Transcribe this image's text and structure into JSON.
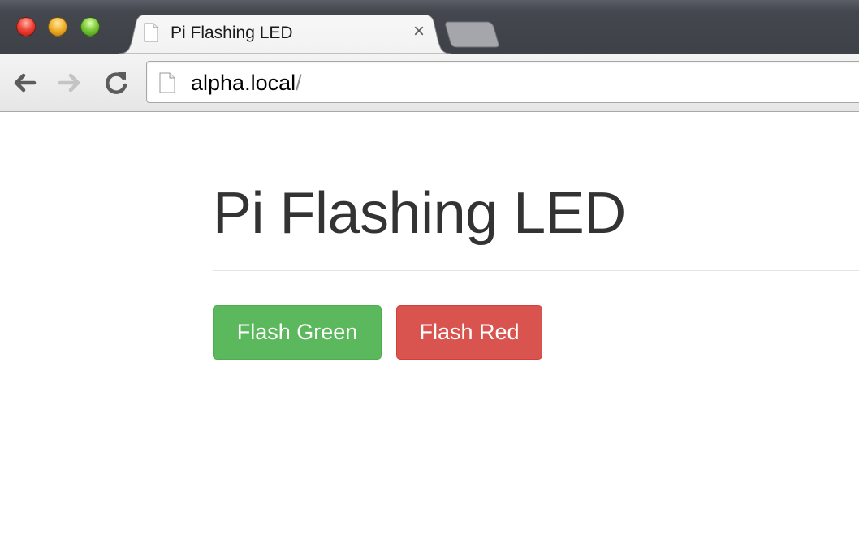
{
  "browser": {
    "tab": {
      "title": "Pi Flashing LED",
      "close_glyph": "×"
    },
    "address_bar": {
      "host": "alpha.local",
      "path": "/"
    },
    "icons": {
      "back": "back-arrow-icon",
      "forward": "forward-arrow-icon",
      "reload": "reload-icon",
      "page": "page-icon"
    }
  },
  "page": {
    "heading": "Pi Flashing LED",
    "buttons": [
      {
        "label": "Flash Green",
        "color": "#5cb85c"
      },
      {
        "label": "Flash Red",
        "color": "#d9534f"
      }
    ]
  }
}
